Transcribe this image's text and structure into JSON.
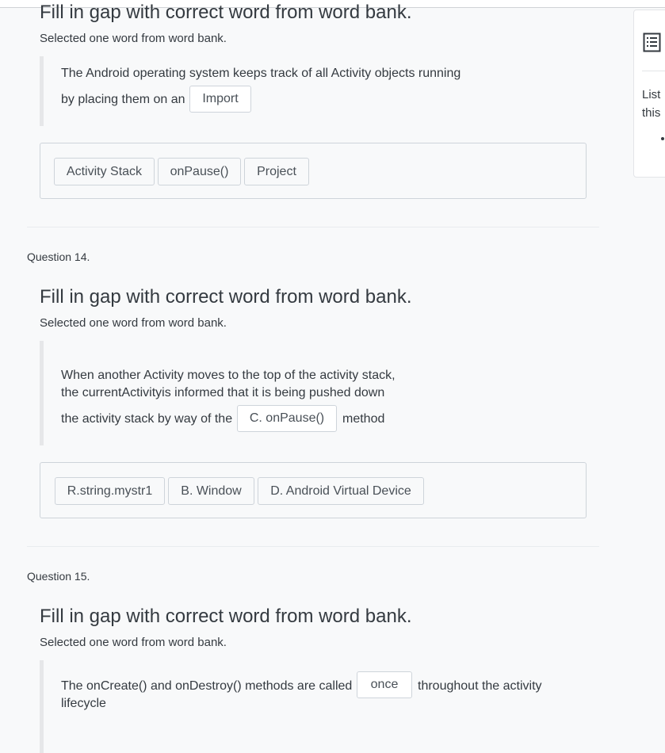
{
  "side_panel": {
    "icon": "list-icon",
    "text_line1": "List",
    "text_line2": "this"
  },
  "q13": {
    "title": "Fill in gap with correct word from word bank.",
    "subtitle": "Selected one word from word bank.",
    "line1": "The Android operating system keeps track of all Activity objects running",
    "line2_before": "by placing them on an",
    "gap_value": "Import",
    "bank": [
      "Activity Stack",
      "onPause()",
      "Project"
    ]
  },
  "q14": {
    "number": "Question 14.",
    "title": "Fill in gap with correct word from word bank.",
    "subtitle": "Selected one word from word bank.",
    "line1": "When another Activity moves to the top of the activity stack,",
    "line2": "the currentActivityis informed that it is being pushed down",
    "line3_before": "the activity stack by way of the",
    "gap_value": "C. onPause()",
    "line3_after": "method",
    "bank": [
      "R.string.mystr1",
      "B. Window",
      "D. Android Virtual Device"
    ]
  },
  "q15": {
    "number": "Question 15.",
    "title": "Fill in gap with correct word from word bank.",
    "subtitle": "Selected one word from word bank.",
    "line1_before": "The onCreate() and onDestroy() methods are called",
    "gap_value": "once",
    "line1_after": "throughout the activity",
    "line2": "lifecycle"
  }
}
